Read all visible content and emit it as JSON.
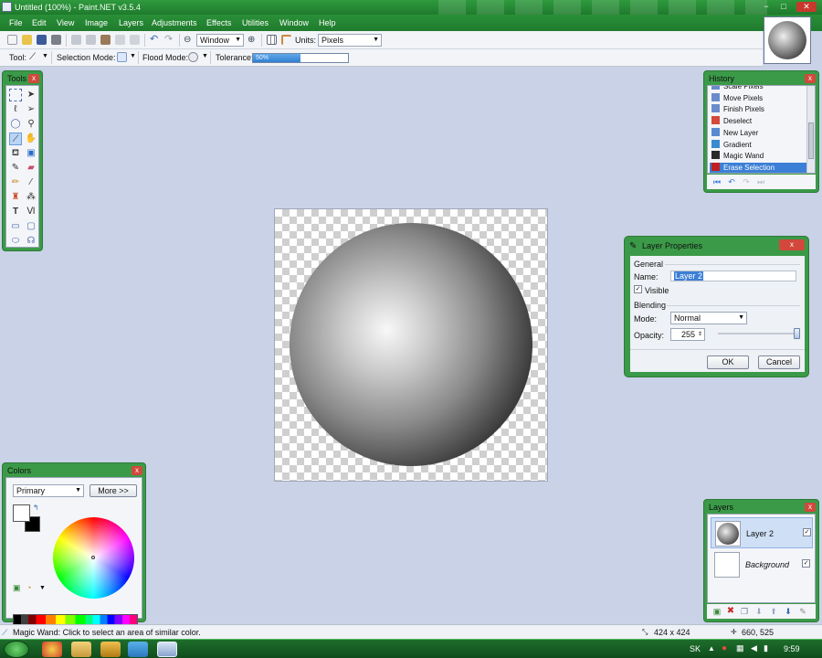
{
  "window": {
    "title": "Untitled (100%) - Paint.NET v3.5.4",
    "controls": [
      "−",
      "□",
      "✕"
    ]
  },
  "menu": [
    "File",
    "Edit",
    "View",
    "Image",
    "Layers",
    "Adjustments",
    "Effects",
    "Utilities",
    "Window",
    "Help"
  ],
  "toolbar": {
    "zoom_value": "Window",
    "units_label": "Units:",
    "units_value": "Pixels"
  },
  "toolbar2": {
    "tool_label": "Tool:",
    "selection_mode_label": "Selection Mode:",
    "flood_mode_label": "Flood Mode:",
    "tolerance_label": "Tolerance:",
    "tolerance_value": "50%",
    "tolerance_fraction": 0.5
  },
  "tools_panel": {
    "title": "Tools",
    "close": "x"
  },
  "history_panel": {
    "title": "History",
    "close": "x",
    "items": [
      {
        "label": "Scale Pixels",
        "color": "#6a8ccc"
      },
      {
        "label": "Move Pixels",
        "color": "#6a8ccc"
      },
      {
        "label": "Finish Pixels",
        "color": "#6a8ccc"
      },
      {
        "label": "Deselect",
        "color": "#d24a3a"
      },
      {
        "label": "New Layer",
        "color": "#5a8ad0"
      },
      {
        "label": "Gradient",
        "color": "#3a8ad0"
      },
      {
        "label": "Magic Wand",
        "color": "#2a2a2a"
      },
      {
        "label": "Erase Selection",
        "color": "#c02020"
      }
    ]
  },
  "layer_properties": {
    "title": "Layer Properties",
    "close": "x",
    "general_label": "General",
    "name_label": "Name:",
    "name_value": "Layer 2",
    "visible_label": "Visible",
    "visible_checked": "✓",
    "blending_label": "Blending",
    "mode_label": "Mode:",
    "mode_value": "Normal",
    "opacity_label": "Opacity:",
    "opacity_value": "255",
    "ok_label": "OK",
    "cancel_label": "Cancel"
  },
  "colors_panel": {
    "title": "Colors",
    "close": "x",
    "primary_select": "Primary",
    "more_label": "More >>"
  },
  "layers_panel": {
    "title": "Layers",
    "close": "x",
    "layers": [
      {
        "name": "Layer 2",
        "checked": "✓"
      },
      {
        "name": "Background",
        "checked": "✓"
      }
    ]
  },
  "status": {
    "message": "Magic Wand: Click to select an area of similar color.",
    "size": "424 x 424",
    "coords": "660, 525"
  },
  "taskbar": {
    "lang": "SK",
    "time": "9:59"
  }
}
